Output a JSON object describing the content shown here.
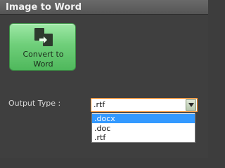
{
  "header": {
    "title": "Image to Word"
  },
  "convert_button": {
    "label": "Convert to\nWord",
    "icon": "convert-doc-icon"
  },
  "output": {
    "label": "Output Type :",
    "selected": ".rtf",
    "options": [
      ".docx",
      ".doc",
      ".rtf"
    ],
    "highlighted_option": ".docx"
  },
  "colors": {
    "accent_border": "#f08a24",
    "button_green": "#6fcf7a",
    "highlight": "#3399ff"
  }
}
